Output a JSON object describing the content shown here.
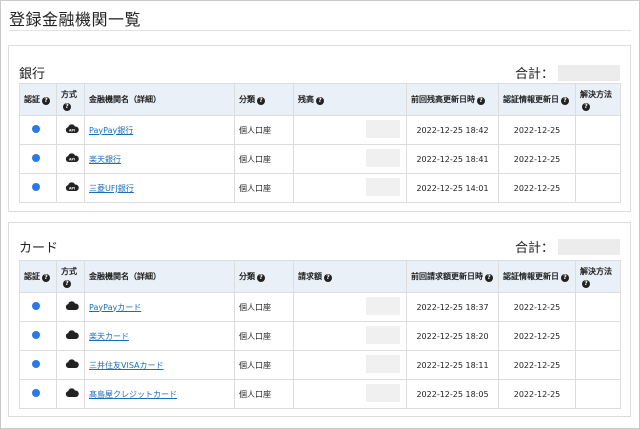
{
  "page": {
    "title": "登録金融機関一覧"
  },
  "bank_section": {
    "heading": "銀行",
    "total_label": "合計：",
    "columns": {
      "auth": "認証",
      "method": "方式",
      "name": "金融機関名（詳細）",
      "category": "分類",
      "amount": "残高",
      "last_update": "前回残高更新日時",
      "auth_update": "認証情報更新日",
      "solution": "解決方法"
    },
    "rows": [
      {
        "name": "PayPay銀行",
        "category": "個人口座",
        "last_update": "2022-12-25 18:42",
        "auth_update": "2022-12-25"
      },
      {
        "name": "楽天銀行",
        "category": "個人口座",
        "last_update": "2022-12-25 18:41",
        "auth_update": "2022-12-25"
      },
      {
        "name": "三菱UFJ銀行",
        "category": "個人口座",
        "last_update": "2022-12-25 14:01",
        "auth_update": "2022-12-25"
      }
    ]
  },
  "card_section": {
    "heading": "カード",
    "total_label": "合計：",
    "columns": {
      "auth": "認証",
      "method": "方式",
      "name": "金融機関名（詳細）",
      "category": "分類",
      "amount": "請求額",
      "last_update": "前回請求額更新日時",
      "auth_update": "認証情報更新日",
      "solution": "解決方法"
    },
    "rows": [
      {
        "name": "PayPayカード",
        "category": "個人口座",
        "last_update": "2022-12-25 18:37",
        "auth_update": "2022-12-25"
      },
      {
        "name": "楽天カード",
        "category": "個人口座",
        "last_update": "2022-12-25 18:20",
        "auth_update": "2022-12-25"
      },
      {
        "name": "三井住友VISAカード",
        "category": "個人口座",
        "last_update": "2022-12-25 18:11",
        "auth_update": "2022-12-25"
      },
      {
        "name": "髙島屋クレジットカード",
        "category": "個人口座",
        "last_update": "2022-12-25 18:05",
        "auth_update": "2022-12-25"
      }
    ]
  },
  "icons": {
    "help": "question-circle-icon",
    "auth_status": "status-dot-icon",
    "method_api": "cloud-api-icon",
    "method_cloud": "cloud-icon"
  },
  "colors": {
    "header_bg": "#e9f0f8",
    "link": "#1a6fb8",
    "status_dot": "#2979e8"
  },
  "help_glyph": "?"
}
